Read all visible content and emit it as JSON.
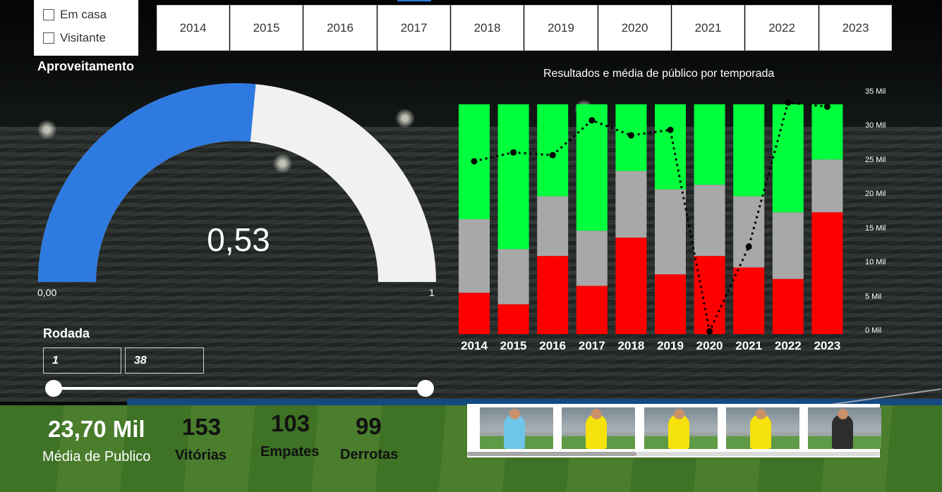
{
  "location_filter": {
    "options": [
      {
        "label": "Em casa",
        "checked": false
      },
      {
        "label": "Visitante",
        "checked": false
      }
    ]
  },
  "year_filter": {
    "years": [
      "2014",
      "2015",
      "2016",
      "2017",
      "2018",
      "2019",
      "2020",
      "2021",
      "2022",
      "2023"
    ]
  },
  "gauge": {
    "title": "Aproveitamento",
    "value": 0.53,
    "value_label": "0,53",
    "min_label": "0,00",
    "max_label": "1",
    "fill_color": "#2f7ae0",
    "track_color": "#f2f1f0"
  },
  "round_filter": {
    "title": "Rodada",
    "min": "1",
    "max": "38"
  },
  "kpis": {
    "attendance_value": "23,70 Mil",
    "attendance_label": "Média de Publico",
    "wins_value": "153",
    "wins_label": "Vitórias",
    "draws_value": "103",
    "draws_label": "Empates",
    "losses_value": "99",
    "losses_label": "Derrotas"
  },
  "chart_data": {
    "type": "bar",
    "title": "Resultados e média de público por temporada",
    "categories": [
      "2014",
      "2015",
      "2016",
      "2017",
      "2018",
      "2019",
      "2020",
      "2021",
      "2022",
      "2023"
    ],
    "stacked": true,
    "normalized": true,
    "series": [
      {
        "name": "Derrotas",
        "color": "#ff0000",
        "values": [
          0.18,
          0.13,
          0.34,
          0.21,
          0.42,
          0.26,
          0.34,
          0.29,
          0.24,
          0.53
        ]
      },
      {
        "name": "Empates",
        "color": "#a8a8a8",
        "values": [
          0.32,
          0.24,
          0.26,
          0.24,
          0.29,
          0.37,
          0.31,
          0.31,
          0.29,
          0.23
        ]
      },
      {
        "name": "Vitórias",
        "color": "#00ff3c",
        "values": [
          0.5,
          0.63,
          0.4,
          0.55,
          0.29,
          0.37,
          0.35,
          0.4,
          0.47,
          0.24
        ]
      }
    ],
    "line_series": {
      "name": "Média de público",
      "values": [
        24900,
        26200,
        25800,
        30900,
        28700,
        29500,
        0,
        12400,
        33500,
        32900
      ]
    },
    "y2_ticks": [
      "0 Mil",
      "5 Mil",
      "10 Mil",
      "15 Mil",
      "20 Mil",
      "25 Mil",
      "30 Mil",
      "35 Mil"
    ],
    "y2lim": [
      0,
      35000
    ]
  },
  "photos": {
    "items": [
      {
        "kit": "#6fc5e8"
      },
      {
        "kit": "#f5e10b"
      },
      {
        "kit": "#f5e10b"
      },
      {
        "kit": "#f5e10b"
      },
      {
        "kit": "#2d2d2d"
      }
    ]
  }
}
